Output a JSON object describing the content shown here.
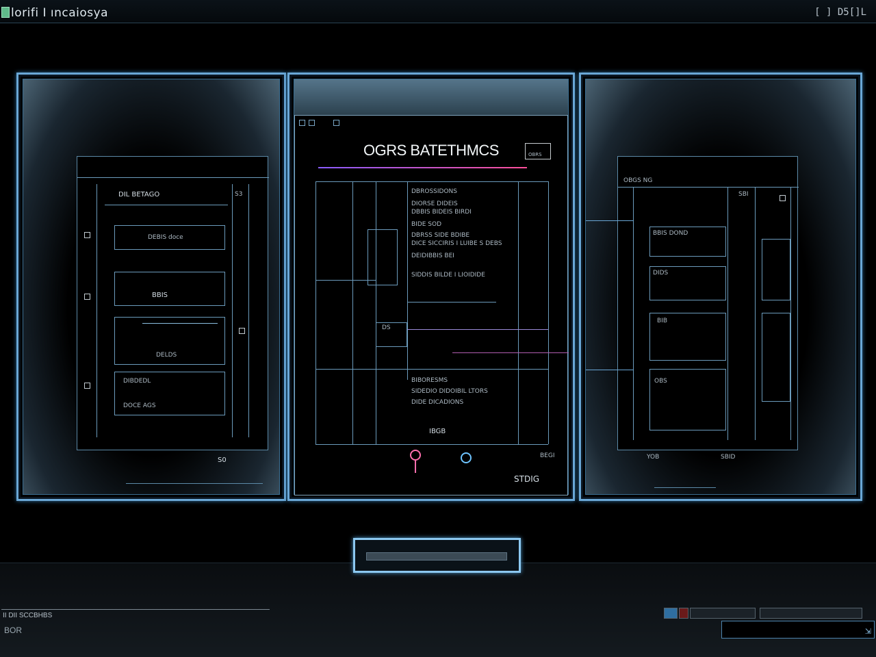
{
  "window": {
    "title": "lorifi I ıncaiosya",
    "controls": "[ ] D5[]L"
  },
  "left_screen": {
    "top_label": "DIL BETAGO",
    "side_label": "S3",
    "rows": [
      "DEBIS doce",
      "BBIS",
      "DELDS",
      "DIBDEDL",
      "DOCE AGS"
    ],
    "footer": "S0"
  },
  "center_doc": {
    "title": "OGRS BATETHMCS",
    "stamp": "OBRS",
    "lines": [
      "DBROSSIDONS",
      "DIORSE DIDEIS",
      "DBBIS BIDEIS BIRDI",
      "BIDE SOD",
      "DBRSS SIDE BDIBE",
      "DICE SICCIRIS I LUIBE S DEBS",
      "DEIDIBBIS BEI",
      "SIDDIS BILDE I LIOIDIDE",
      "BIBORESMS",
      "SIDEDIO DIDOIBIL LTORS",
      "DIDE DICADIONS"
    ],
    "mini_label": "DS",
    "badge": "IBGB",
    "right_tag": "BEGI",
    "bottom_tag": "STDIG"
  },
  "right_screen": {
    "top_label": "OBGS NG",
    "side_label": "SBI",
    "rows": [
      "BBIS DOND",
      "DIDS",
      "BIB",
      "OBS",
      "YOB"
    ],
    "corner": "SBID"
  },
  "action_button": {
    "label": ""
  },
  "status_bar": {
    "text": "II DII SCCBHBS",
    "sub": "BOR"
  },
  "colors": {
    "frame_blue": "#6aa7d6",
    "accent_pink": "#ff6fae",
    "accent_purple": "#8a5cff"
  }
}
